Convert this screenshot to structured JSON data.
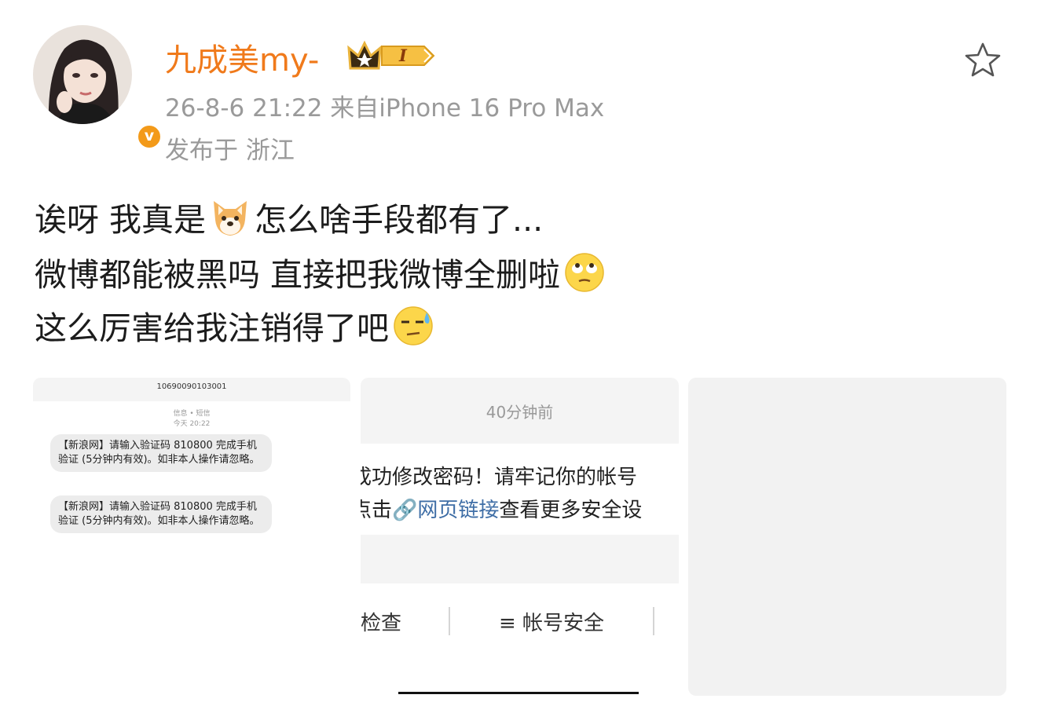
{
  "header": {
    "username": "九成美my-",
    "vip_level": "I",
    "verified_mark": "v",
    "meta": "26-8-6 21:22  来自iPhone 16 Pro Max",
    "location": "发布于 浙江"
  },
  "post": {
    "line1_a": "诶呀 我真是",
    "line1_b": "怎么啥手段都有了...",
    "line2": "微博都能被黑吗 直接把我微博全删啦",
    "line3": "这么厉害给我注销得了吧"
  },
  "images": {
    "sms": {
      "number": "10690090103001",
      "channel": "信息 • 短信",
      "time": "今天 20:22",
      "message1": "【新浪网】请输入验证码 810800 完成手机验证 (5分钟内有效)。如非本人操作请忽略。",
      "message2": "【新浪网】请输入验证码 810800 完成手机验证 (5分钟内有效)。如非本人操作请忽略。"
    },
    "notice": {
      "time": "40分钟前",
      "line1": "成功修改密码！请牢记你的帐号",
      "line2_a": "点击",
      "line2_link": "网页链接",
      "line2_b": "查看更多安全设",
      "btn_left": "检查",
      "btn_right": "≡ 帐号安全"
    }
  },
  "colors": {
    "username": "#f07a1b",
    "meta": "#9a9a9a",
    "link": "#3f6ea6",
    "verified": "#f39a19"
  },
  "icons": [
    "star-icon",
    "crown-icon",
    "verified-icon",
    "dog-emoji-icon",
    "eye-roll-emoji-icon",
    "sweat-emoji-icon",
    "link-icon"
  ]
}
